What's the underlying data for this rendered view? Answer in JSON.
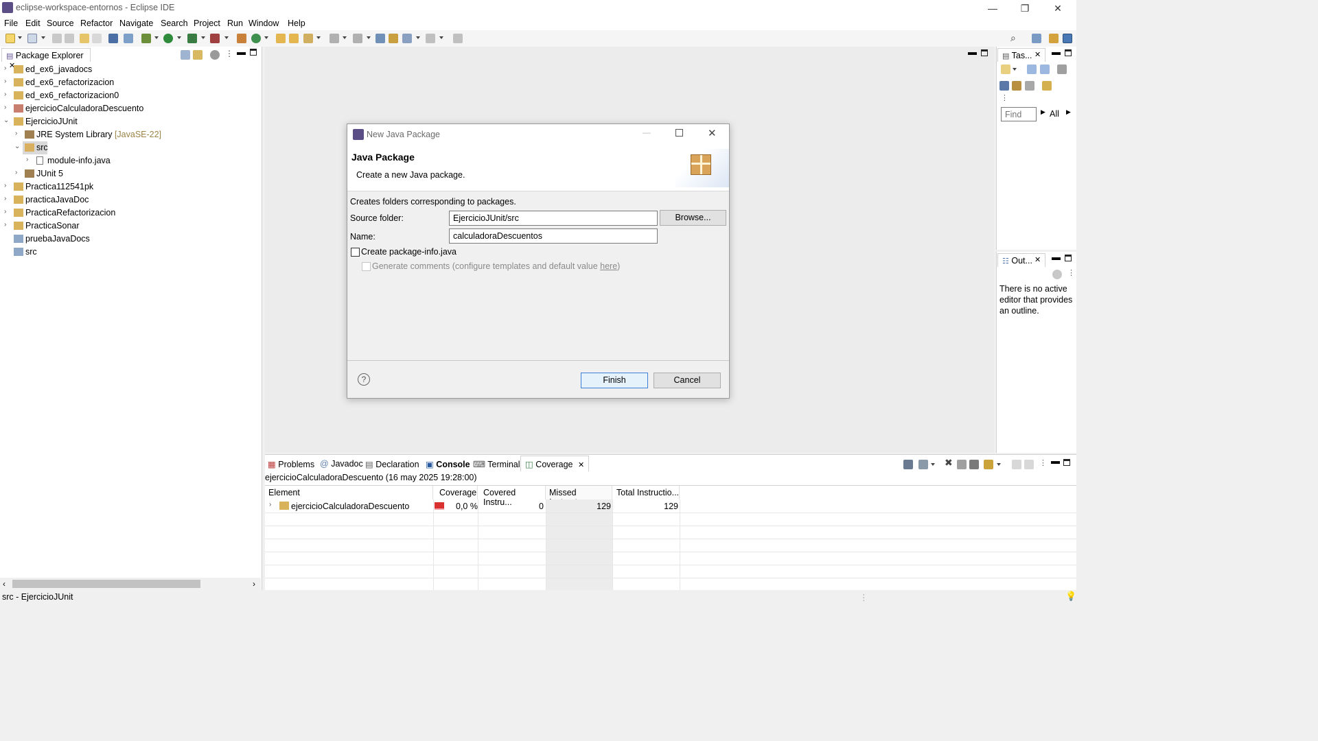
{
  "window": {
    "title": "eclipse-workspace-entornos - Eclipse IDE",
    "controls": {
      "minimize": "—",
      "restore": "❐",
      "close": "✕"
    }
  },
  "menu": [
    "File",
    "Edit",
    "Source",
    "Refactor",
    "Navigate",
    "Search",
    "Project",
    "Run",
    "Window",
    "Help"
  ],
  "package_explorer": {
    "tab_label": "Package Explorer",
    "items": [
      {
        "label": "ed_ex6_javadocs",
        "decor": ""
      },
      {
        "label": "ed_ex6_refactorizacion",
        "decor": ""
      },
      {
        "label": "ed_ex6_refactorizacion0",
        "decor": ""
      },
      {
        "label": "ejercicioCalculadoraDescuento",
        "decor": ""
      },
      {
        "label": "EjercicioJUnit",
        "decor": ""
      },
      {
        "label": "JRE System Library",
        "decor": "[JavaSE-22]"
      },
      {
        "label": "src",
        "decor": ""
      },
      {
        "label": "module-info.java",
        "decor": ""
      },
      {
        "label": "JUnit 5",
        "decor": ""
      },
      {
        "label": "Practica112541pk",
        "decor": ""
      },
      {
        "label": "practicaJavaDoc",
        "decor": ""
      },
      {
        "label": "PracticaRefactorizacion",
        "decor": ""
      },
      {
        "label": "PracticaSonar",
        "decor": ""
      },
      {
        "label": "pruebaJavaDocs",
        "decor": ""
      },
      {
        "label": "src",
        "decor": ""
      }
    ]
  },
  "task_view": {
    "tab_label": "Tas...",
    "find_placeholder": "Find",
    "all_label": "All"
  },
  "outline_view": {
    "tab_label": "Out...",
    "message": "There is no active editor that provides an outline."
  },
  "bottom": {
    "tabs": [
      "Problems",
      "Javadoc",
      "Declaration",
      "Console",
      "Terminal",
      "Coverage"
    ],
    "session": "ejercicioCalculadoraDescuento (16 may 2025 19:28:00)",
    "columns": [
      "Element",
      "Coverage",
      "Covered Instru...",
      "Missed Instruct...",
      "Total Instructio..."
    ],
    "rows": [
      {
        "element": "ejercicioCalculadoraDescuento",
        "coverage": "0,0 %",
        "covered": "0",
        "missed": "129",
        "total": "129"
      }
    ]
  },
  "status": {
    "text": "src - EjercicioJUnit"
  },
  "dialog": {
    "title": "New Java Package",
    "heading": "Java Package",
    "subheading": "Create a new Java package.",
    "description": "Creates folders corresponding to packages.",
    "source_folder_label": "Source folder:",
    "source_folder_value": "EjercicioJUnit/src",
    "browse_label": "Browse...",
    "name_label": "Name:",
    "name_value": "calculadoraDescuentos",
    "create_info_label": "Create package-info.java",
    "generate_comments_label": "Generate comments (configure templates and default value ",
    "here_link": "here",
    "generate_comments_suffix": ")",
    "finish_label": "Finish",
    "cancel_label": "Cancel",
    "help_glyph": "?"
  }
}
